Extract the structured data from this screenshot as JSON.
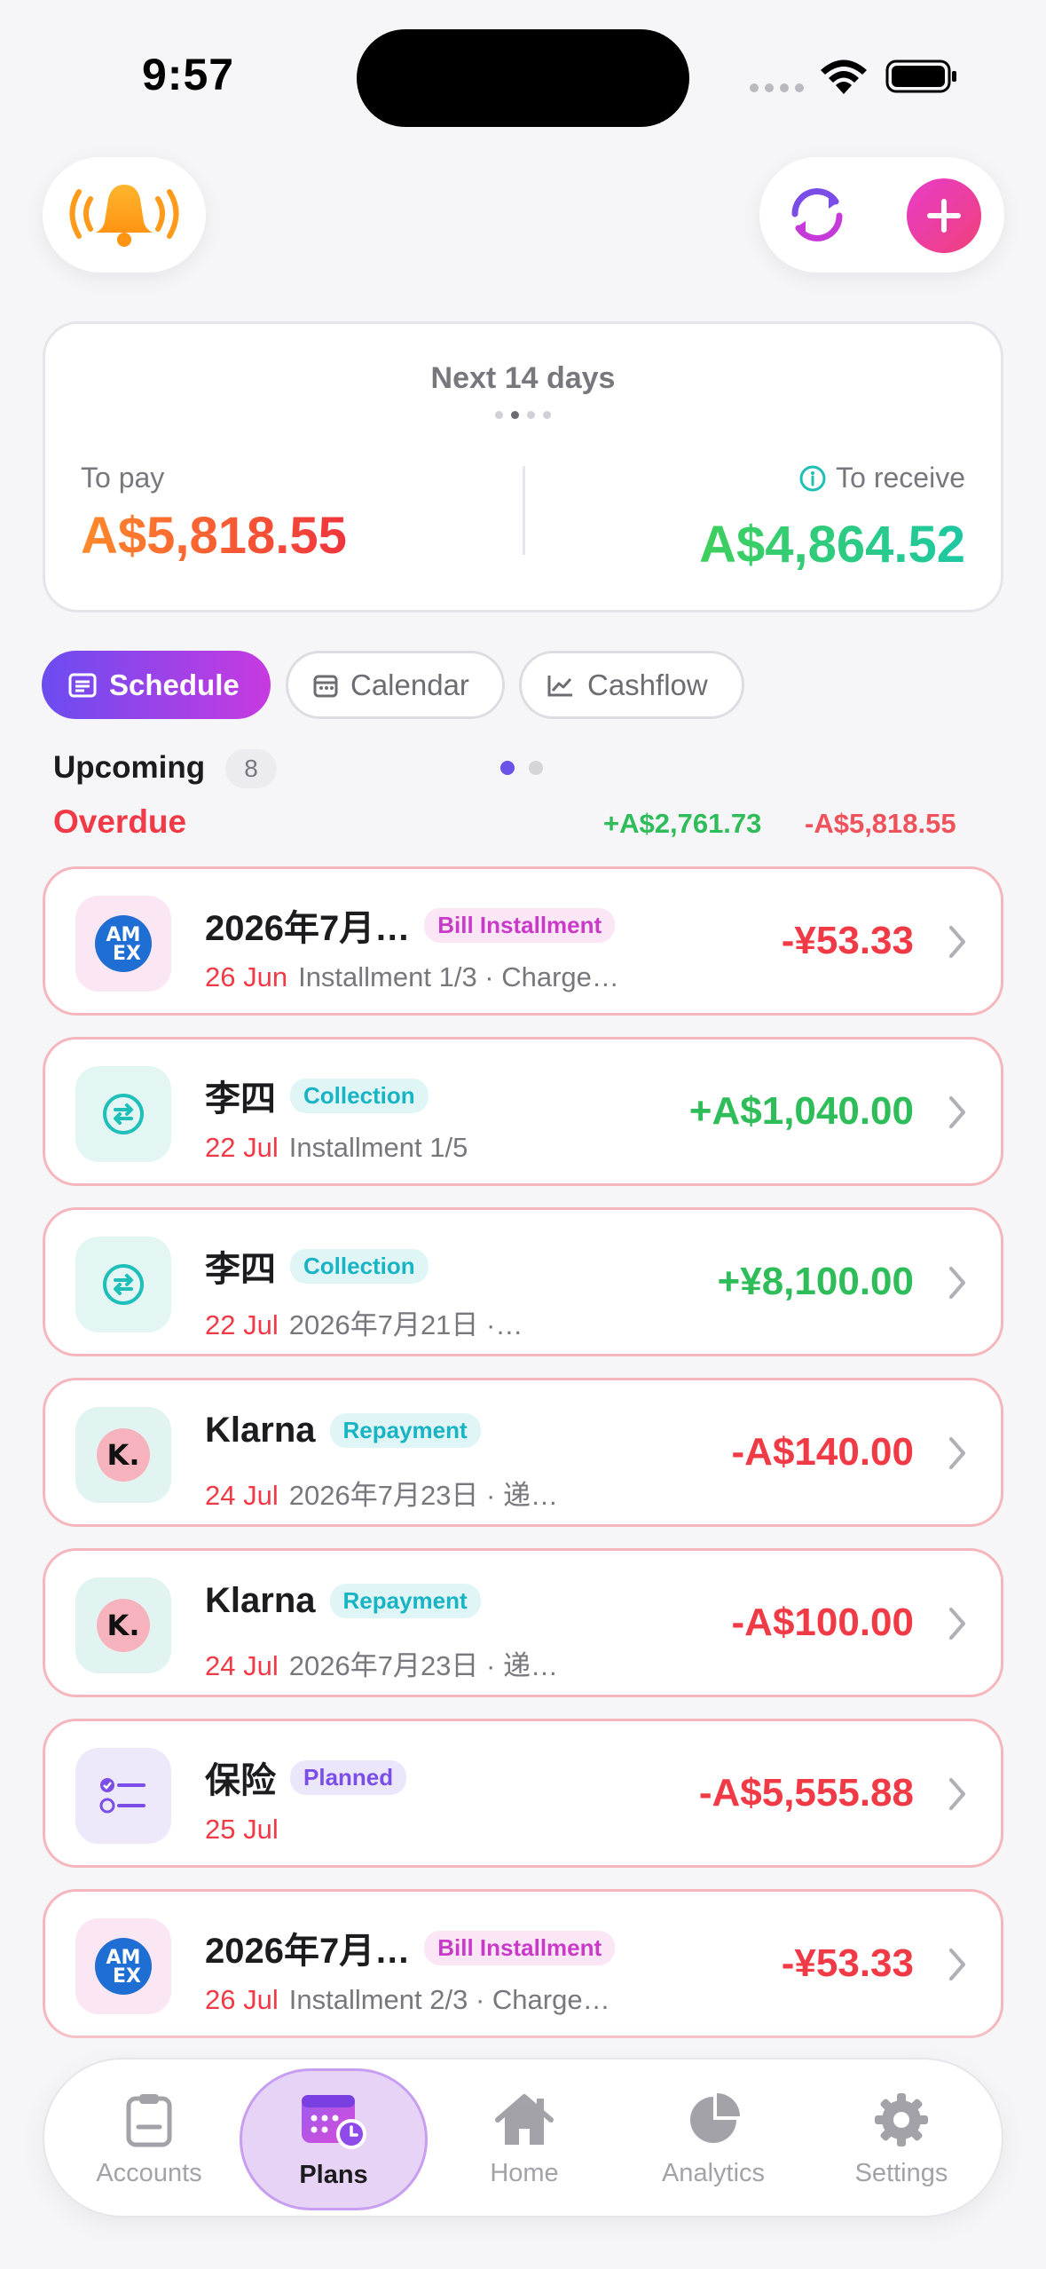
{
  "status_bar": {
    "time": "9:57"
  },
  "summary": {
    "period": "Next 14 days",
    "to_pay_label": "To pay",
    "to_pay_amount": "A$5,818.55",
    "to_receive_label": "To receive",
    "to_receive_amount": "A$4,864.52"
  },
  "segments": {
    "schedule": "Schedule",
    "calendar": "Calendar",
    "cashflow": "Cashflow"
  },
  "section": {
    "upcoming_label": "Upcoming",
    "upcoming_count": "8",
    "overdue_label": "Overdue",
    "overdue_plus": "+A$2,761.73",
    "overdue_minus": "-A$5,818.55"
  },
  "items": [
    {
      "title": "2026年7月…",
      "tag": "Bill Installment",
      "date": "26 Jun",
      "detail": "Installment 1/3 · Charge…",
      "amount": "-¥53.33",
      "icon": "amex-icon"
    },
    {
      "title": "李四",
      "tag": "Collection",
      "date": "22 Jul",
      "detail": "Installment 1/5",
      "amount": "+A$1,040.00",
      "icon": "collection-icon"
    },
    {
      "title": "李四",
      "tag": "Collection",
      "date": "22 Jul",
      "detail": "2026年7月21日 ·…",
      "amount": "+¥8,100.00",
      "icon": "collection-icon"
    },
    {
      "title": "Klarna",
      "tag": "Repayment",
      "date": "24 Jul",
      "detail": "2026年7月23日 · 递…",
      "amount": "-A$140.00",
      "icon": "klarna-icon"
    },
    {
      "title": "Klarna",
      "tag": "Repayment",
      "date": "24 Jul",
      "detail": "2026年7月23日 · 递…",
      "amount": "-A$100.00",
      "icon": "klarna-icon"
    },
    {
      "title": "保险",
      "tag": "Planned",
      "date": "25 Jul",
      "detail": "",
      "amount": "-A$5,555.88",
      "icon": "planned-icon"
    },
    {
      "title": "2026年7月…",
      "tag": "Bill Installment",
      "date": "26 Jul",
      "detail": "Installment 2/3 · Charge…",
      "amount": "-¥53.33",
      "icon": "amex-icon"
    }
  ],
  "tab_bar": {
    "accounts": "Accounts",
    "plans": "Plans",
    "home": "Home",
    "analytics": "Analytics",
    "settings": "Settings"
  },
  "colors": {
    "accent": "#6b4cf0",
    "negative": "#f03a46",
    "positive": "#2fbd5a",
    "card_border_overdue": "#f6b6bd"
  }
}
